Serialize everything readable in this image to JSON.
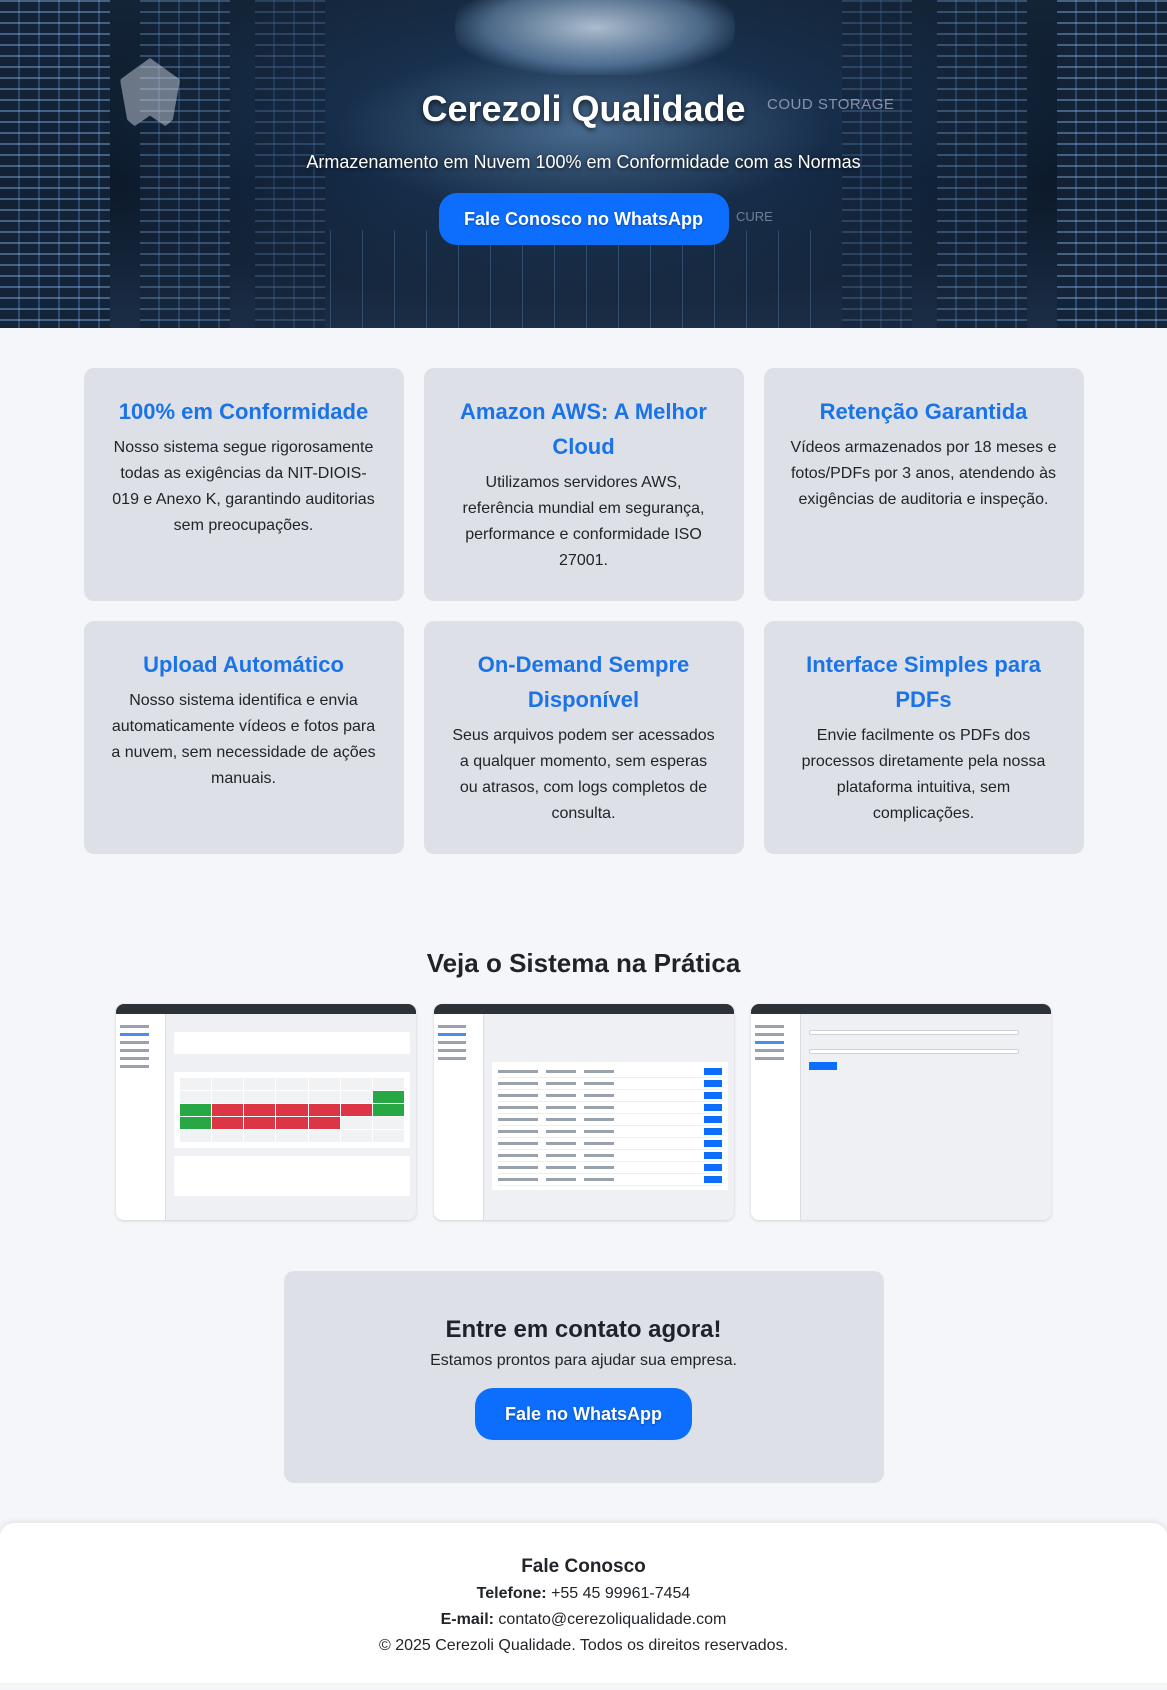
{
  "hero": {
    "title": "Cerezoli Qualidade",
    "subtitle": "Armazenamento em Nuvem 100% em Conformidade com as Normas",
    "cta_label": "Fale Conosco no WhatsApp",
    "bg_text_storage": "COUD STORAGE",
    "bg_text_secure": "CURE"
  },
  "features": [
    {
      "title": "100% em Conformidade",
      "text": "Nosso sistema segue rigorosamente todas as exigências da NIT-DIOIS-019 e Anexo K, garantindo auditorias sem preocupações."
    },
    {
      "title": "Amazon AWS: A Melhor Cloud",
      "text": "Utilizamos servidores AWS, referência mundial em segurança, performance e conformidade ISO 27001."
    },
    {
      "title": "Retenção Garantida",
      "text": "Vídeos armazenados por 18 meses e fotos/PDFs por 3 anos, atendendo às exigências de auditoria e inspeção."
    },
    {
      "title": "Upload Automático",
      "text": "Nosso sistema identifica e envia automaticamente vídeos e fotos para a nuvem, sem necessidade de ações manuais."
    },
    {
      "title": "On-Demand Sempre Disponível",
      "text": "Seus arquivos podem ser acessados a qualquer momento, sem esperas ou atrasos, com logs completos de consulta."
    },
    {
      "title": "Interface Simples para PDFs",
      "text": "Envie facilmente os PDFs dos processos diretamente pela nossa plataforma intuitiva, sem complicações."
    }
  ],
  "showcase": {
    "title": "Veja o Sistema na Prática"
  },
  "contact": {
    "title": "Entre em contato agora!",
    "subtitle": "Estamos prontos para ajudar sua empresa.",
    "cta_label": "Fale no WhatsApp"
  },
  "footer": {
    "title": "Fale Conosco",
    "phone_label": "Telefone:",
    "phone": "+55 45 99961-7454",
    "email_label": "E-mail:",
    "email": "contato@cerezoliqualidade.com",
    "copyright": "© 2025 Cerezoli Qualidade. Todos os direitos reservados."
  },
  "colors": {
    "accent": "#0d6efd",
    "feature_title": "#1a73e8",
    "card_bg": "#dde1e7",
    "page_bg": "#f4f6f9"
  }
}
